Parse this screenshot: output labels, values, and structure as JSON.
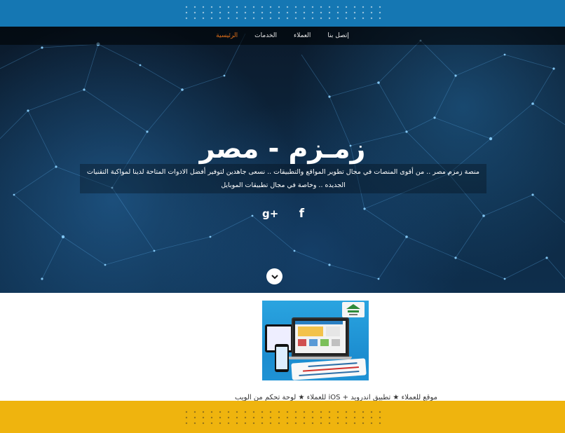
{
  "nav": {
    "items": [
      {
        "label": "إتصل بنا"
      },
      {
        "label": "العملاء"
      },
      {
        "label": "الخدمات"
      },
      {
        "label": "الرئيسية",
        "active": true
      }
    ]
  },
  "hero": {
    "title": "زمـزم - مصر",
    "description": "منصة زمزم مصر .. من أقوى المنصات في مجال تطوير المواقع والتطبيقات .. نسعى جاهدين لتوفير أفضل الادوات المتاحة لدينا لمواكبة التقنيات الجديده .. وخاصة في مجال تطبيقات الموبايل",
    "social": [
      {
        "icon": "facebook-icon",
        "glyph": "f"
      },
      {
        "icon": "google-plus-icon",
        "glyph": "g+"
      }
    ],
    "scroll_icon": "chevron-down-icon"
  },
  "product": {
    "caption": "موقع للعملاء ★ تطبيق اندرويد + iOS للعملاء ★ لوحة تحكم من الويب"
  },
  "colors": {
    "top_band": "#1577b3",
    "bottom_band": "#efb40e",
    "nav_active": "#e0701a",
    "hero_bg": "#0d2740"
  }
}
